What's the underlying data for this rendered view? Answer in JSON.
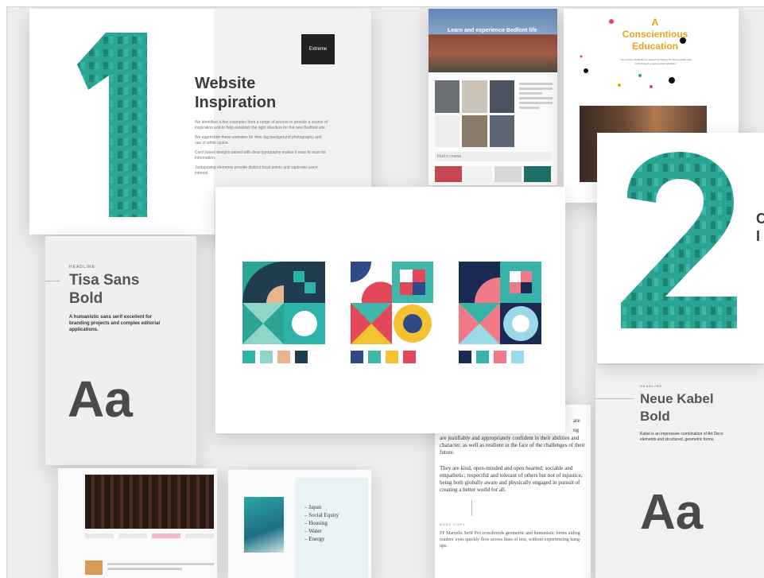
{
  "inspiration": {
    "numeral": "1",
    "badge": "Extreme",
    "title_line1": "Website",
    "title_line2": "Inspiration",
    "paragraphs": [
      "We identified a few examples from a range of sectors to provide a source of inspiration and to help establish the right direction for the new Bedfont site.",
      "We appreciate these websites for their big background photography and use of white space.",
      "Card based designs paired with clear typography makes it easy to scan for information.",
      "Juxtaposing elements provide distinct focal points and captivate users' interest."
    ]
  },
  "school_site": {
    "hero_text": "Learn and experience Bedfont life",
    "search_label": "Find a course"
  },
  "conscientious": {
    "line1": "A",
    "line2": "Conscientious",
    "line3": "Education",
    "body": "The school is dedicated to delivering children the best possible start in life through a well-rounded education."
  },
  "tisa": {
    "label": "HEADLINE",
    "name_line1": "Tisa Sans",
    "name_line2": "Bold",
    "desc": "A humanistic sans serif excellent for branding projects and complex editorial applications.",
    "sample": "Aa"
  },
  "number_two": {
    "numeral": "2",
    "partial1": "C",
    "partial2": "I"
  },
  "kabel": {
    "label": "HEADLINE",
    "name_line1": "Neue Kabel",
    "name_line2": "Bold",
    "desc": "Kabel is an impressive combination of Art Deco elements and structured, geometric forms.",
    "sample": "Aa"
  },
  "body_copy": {
    "top_partial": "are",
    "top_partial2": "ng",
    "para1": "are justifiably and appropriately confident in their abilities and character, as well as resilient in the face of the challenges of their future.",
    "para2": "They are kind, open-minded and open hearted; sociable and empathetic; respectful and tolerant of others but not of injustice, being both globally aware and physically engaged in pursuit of creating a better world for all.",
    "label": "BODY COPY",
    "desc": "FF Marselis Serif Pro crossbreeds geometric and humanistic forms aiding readers' eyes quickly flow across lines of text, without experiencing hang-ups."
  },
  "menu_site": {
    "items": [
      "Japan",
      "Social Equity",
      "Housing",
      "Water",
      "Energy"
    ]
  },
  "swatches": {
    "set1": [
      "#2bb3a8",
      "#8fd6c8",
      "#e8b48e",
      "#1f3d4f"
    ],
    "set2": [
      "#2f4a86",
      "#3fb8aa",
      "#f2c230",
      "#e3485a"
    ],
    "set3": [
      "#1b2a52",
      "#34b3a6",
      "#f07b86",
      "#9bd8e8"
    ]
  }
}
